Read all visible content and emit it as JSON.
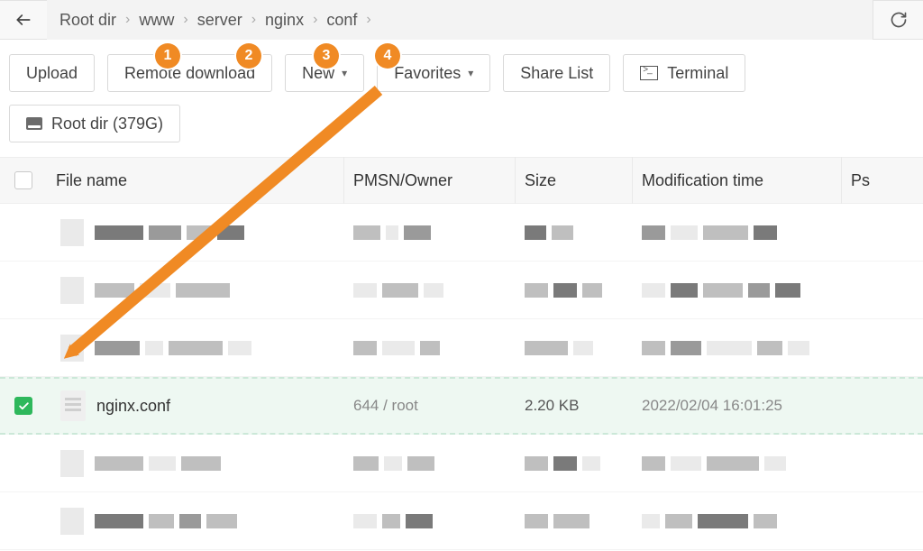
{
  "breadcrumb": {
    "items": [
      "Root dir",
      "www",
      "server",
      "nginx",
      "conf"
    ]
  },
  "toolbar": {
    "upload": "Upload",
    "remote_download": "Remote download",
    "new": "New",
    "favorites": "Favorites",
    "share_list": "Share List",
    "terminal": "Terminal",
    "root_dir": "Root dir (379G)"
  },
  "columns": {
    "name": "File name",
    "pmsn": "PMSN/Owner",
    "size": "Size",
    "mtime": "Modification time",
    "ps": "Ps"
  },
  "rows": {
    "selected": {
      "name": "nginx.conf",
      "pmsn": "644 / root",
      "size": "2.20 KB",
      "mtime": "2022/02/04 16:01:25"
    }
  },
  "annotations": {
    "badges": [
      "1",
      "2",
      "3",
      "4"
    ]
  }
}
